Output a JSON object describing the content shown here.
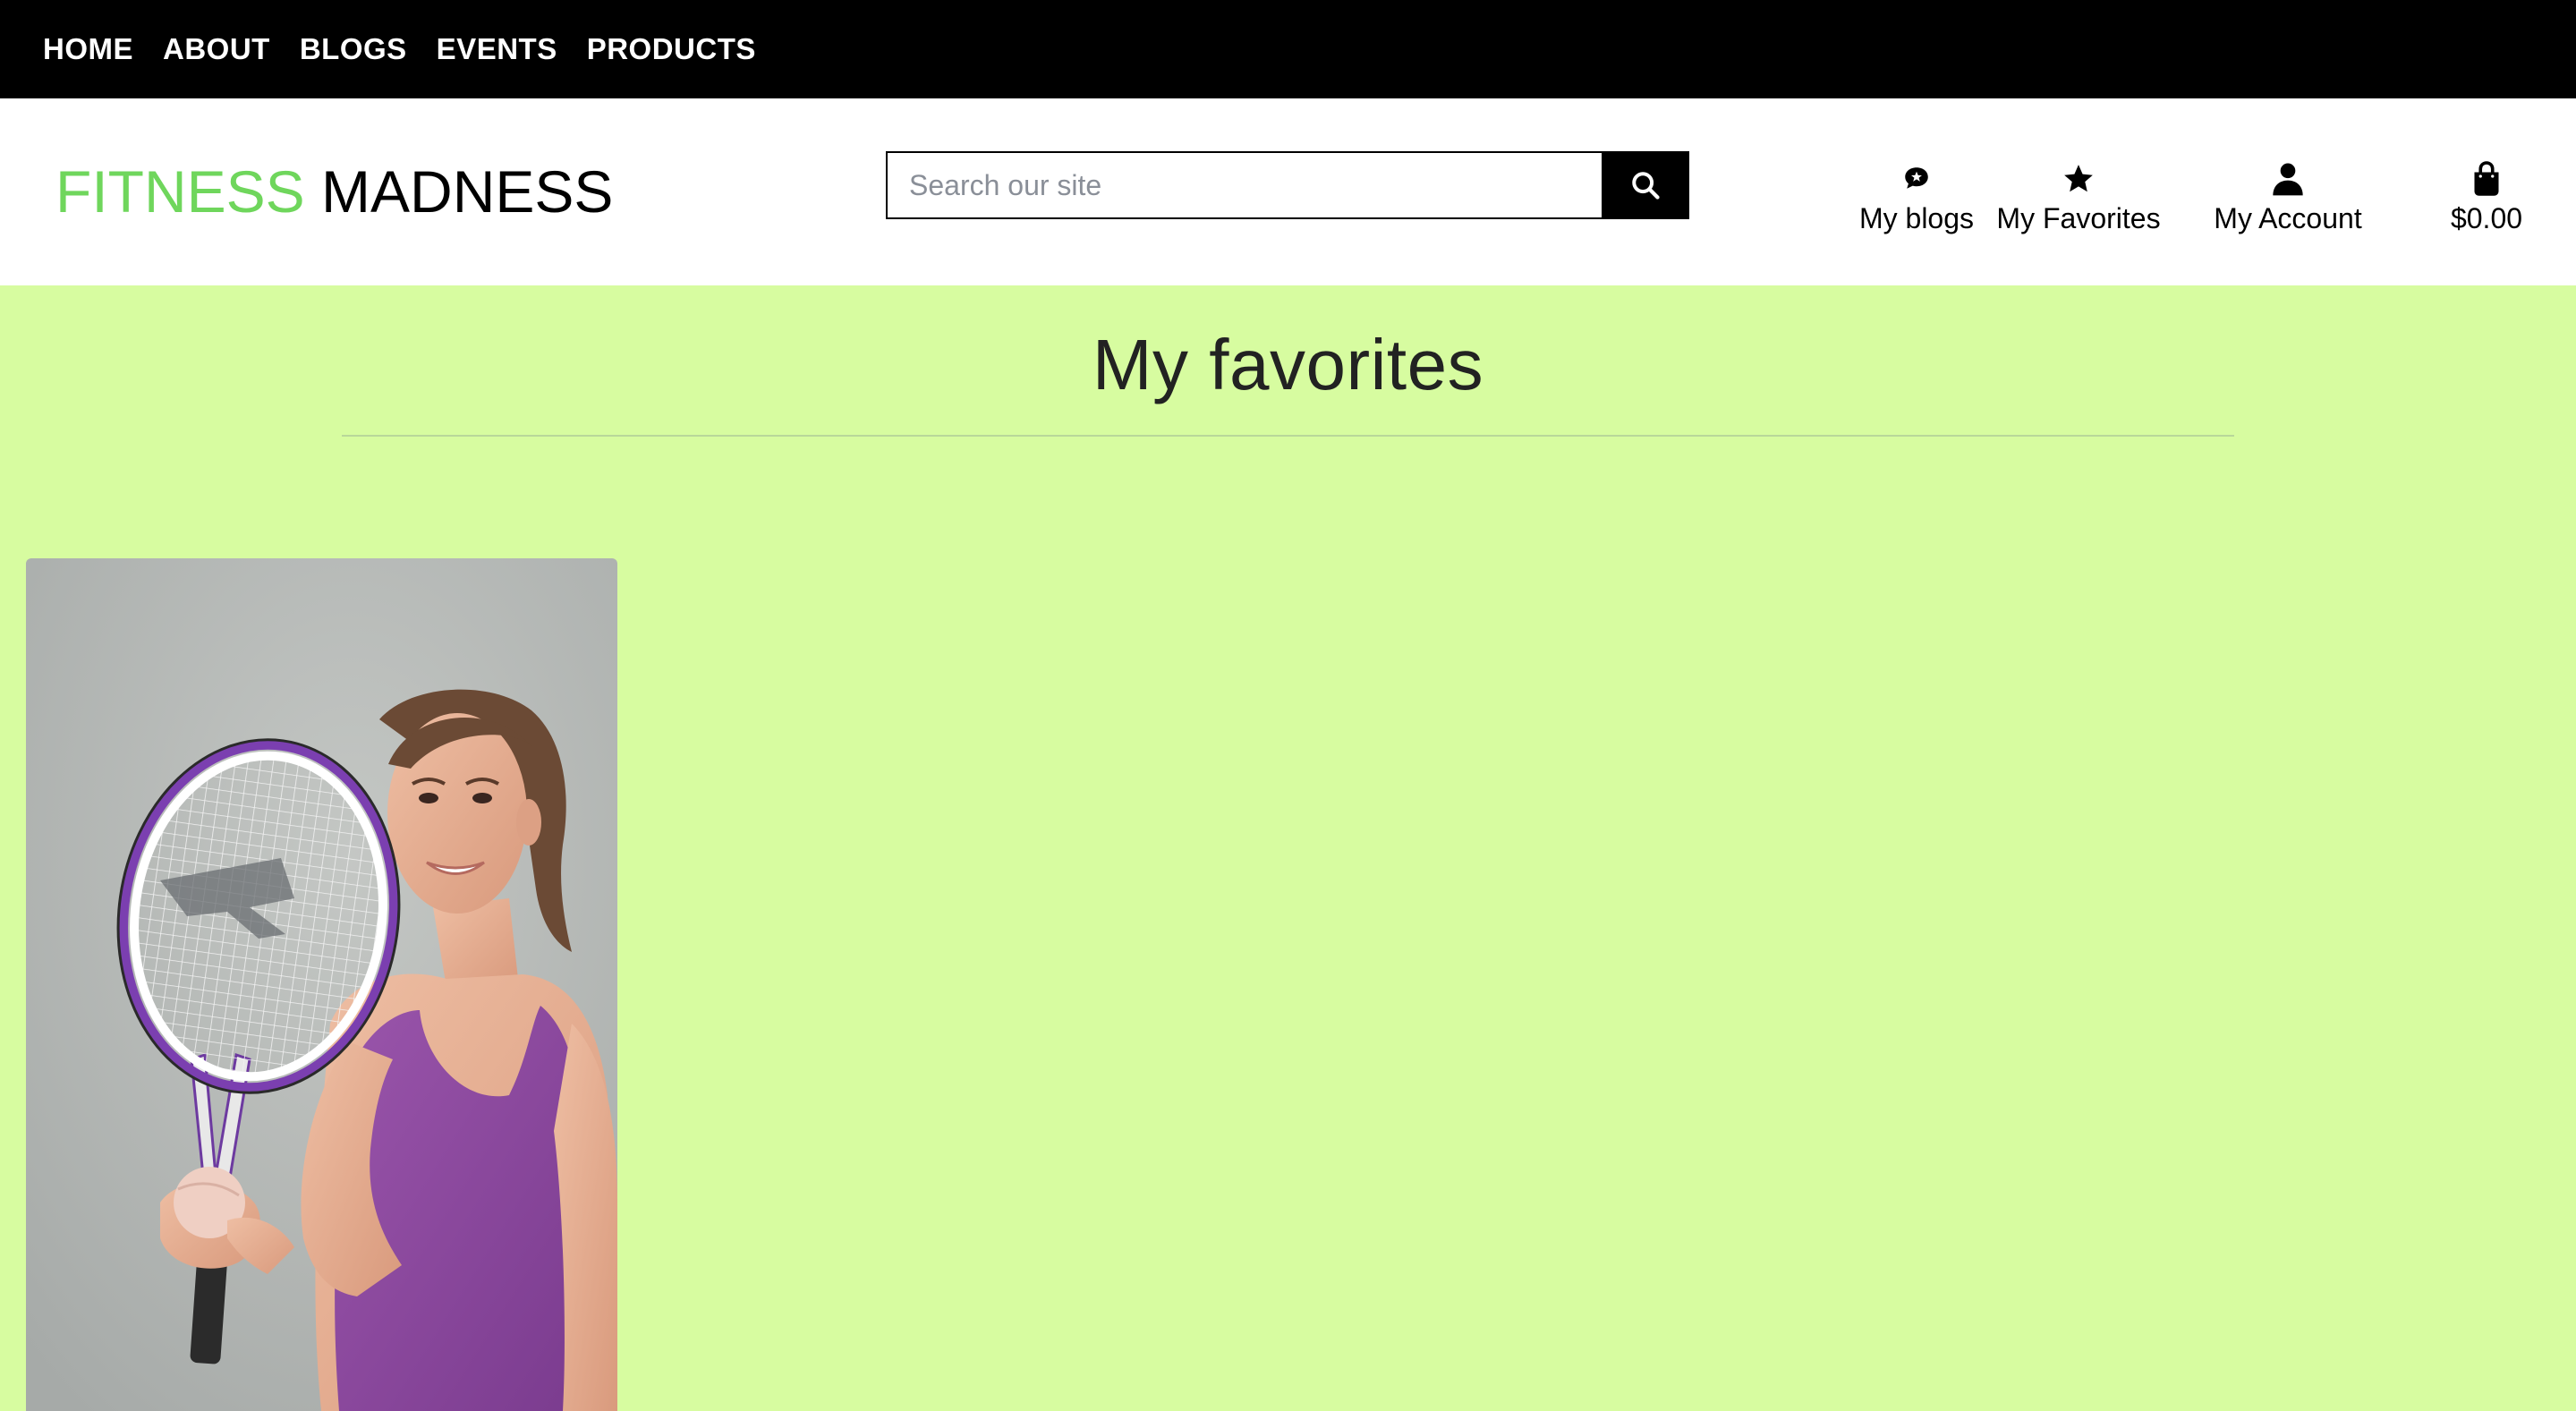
{
  "topnav": {
    "items": [
      {
        "label": "HOME"
      },
      {
        "label": "ABOUT"
      },
      {
        "label": "BLOGS"
      },
      {
        "label": "EVENTS"
      },
      {
        "label": "PRODUCTS"
      }
    ]
  },
  "header": {
    "logo_part1": "FITNESS",
    "logo_part2": "MADNESS",
    "search_placeholder": "Search our site",
    "search_icon": "search-icon",
    "links": {
      "blogs": {
        "label": "My blogs",
        "icon": "blog-comment-icon"
      },
      "favorites": {
        "label": "My Favorites",
        "icon": "star-icon"
      },
      "account": {
        "label": "My Account",
        "icon": "user-icon"
      },
      "cart": {
        "label": "$0.00",
        "icon": "shopping-bag-icon"
      }
    }
  },
  "main": {
    "title": "My favorites",
    "favorites": [
      {
        "image": "woman-with-tennis-racket-photo"
      }
    ]
  },
  "colors": {
    "topnav_bg": "#000000",
    "page_bg": "#d7fca0",
    "logo_accent": "#6fd65c",
    "racket_accent": "#7b3fb0",
    "top_purple": "#8e4aa0"
  }
}
